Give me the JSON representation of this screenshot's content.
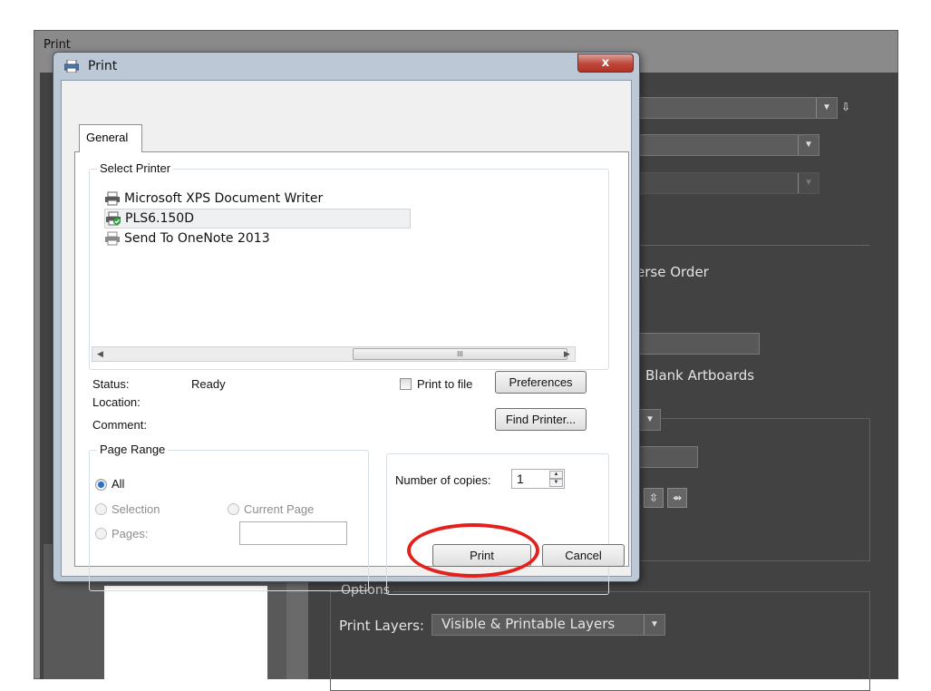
{
  "background_window": {
    "title": "Print",
    "options_legend": "Options",
    "reverse_order_text": "erse Order",
    "blank_artboards_text": "Blank Artboards",
    "print_layers_label": "Print Layers:",
    "print_layers_value": "Visible & Printable Layers"
  },
  "dialog": {
    "title": "Print",
    "close_label": "x",
    "tab_general": "General",
    "select_printer_legend": "Select Printer",
    "printers": [
      {
        "label": "Microsoft XPS Document Writer",
        "icon": "printer-icon"
      },
      {
        "label": "PLS6.150D",
        "icon": "printer-default-check-icon"
      },
      {
        "label": "Send To OneNote 2013",
        "icon": "printer-icon"
      }
    ],
    "scrollbar_thumb_grip": "III",
    "status_label": "Status:",
    "status_value": "Ready",
    "location_label": "Location:",
    "comment_label": "Comment:",
    "print_to_file_label": "Print to file",
    "preferences_button": "Preferences",
    "find_printer_button": "Find Printer...",
    "page_range_legend": "Page Range",
    "range_all": "All",
    "range_selection": "Selection",
    "range_current_page": "Current Page",
    "range_pages": "Pages:",
    "copies_label": "Number of copies:",
    "copies_value": "1",
    "print_button": "Print",
    "cancel_button": "Cancel"
  },
  "colors": {
    "highlight_circle": "#e3201b",
    "dialog_frame": "#bcc8d6",
    "background_panel": "#424242"
  }
}
